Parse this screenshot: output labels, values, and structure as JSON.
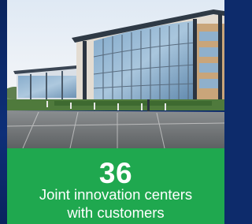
{
  "stat": {
    "value": "36",
    "caption_line1": "Joint innovation centers",
    "caption_line2": "with customers"
  },
  "colors": {
    "panel_green": "#1fa84f",
    "strip_blue": "#0d2b6b",
    "text": "#ffffff"
  }
}
